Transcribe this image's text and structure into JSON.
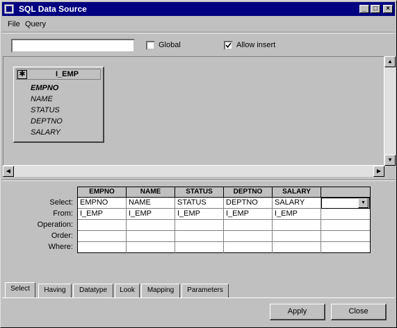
{
  "window": {
    "title": "SQL Data Source",
    "min_symbol": "_",
    "max_symbol": "□",
    "close_symbol": "×"
  },
  "menu": {
    "file": "File",
    "query": "Query"
  },
  "toolbar": {
    "input_value": "",
    "global_label": "Global",
    "global_checked": false,
    "allow_insert_label": "Allow insert",
    "allow_insert_checked": true
  },
  "table_box": {
    "star": "✱",
    "name": "I_EMP",
    "fields": [
      "EMPNO",
      "NAME",
      "STATUS",
      "DEPTNO",
      "SALARY"
    ]
  },
  "grid": {
    "row_labels": [
      "Select:",
      "From:",
      "Operation:",
      "Order:",
      "Where:"
    ],
    "columns": [
      "EMPNO",
      "NAME",
      "STATUS",
      "DEPTNO",
      "SALARY",
      ""
    ],
    "select": [
      "EMPNO",
      "NAME",
      "STATUS",
      "DEPTNO",
      "SALARY",
      ""
    ],
    "from": [
      "I_EMP",
      "I_EMP",
      "I_EMP",
      "I_EMP",
      "I_EMP",
      ""
    ]
  },
  "tabs": [
    "Select",
    "Having",
    "Datatype",
    "Look",
    "Mapping",
    "Parameters"
  ],
  "active_tab": "Select",
  "buttons": {
    "apply": "Apply",
    "close": "Close"
  },
  "colors": {
    "titlebar": "#000080",
    "face": "#c0c0c0"
  }
}
